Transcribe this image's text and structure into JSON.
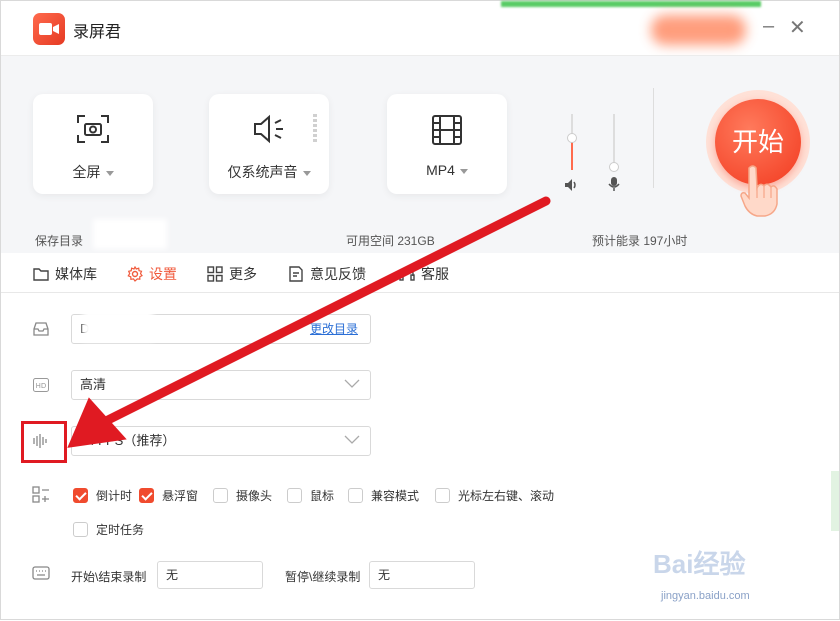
{
  "app": {
    "title": "录屏君"
  },
  "top": {
    "cards": [
      {
        "label": "全屏",
        "icon": "fullscreen-camera-icon"
      },
      {
        "label": "仅系统声音",
        "icon": "speaker-icon"
      },
      {
        "label": "MP4",
        "icon": "film-icon"
      }
    ],
    "start_label": "开始",
    "save_dir_label": "保存目录",
    "free_space": "可用空间  231GB",
    "estimated": "预计能录  197小时"
  },
  "nav": [
    {
      "label": "媒体库",
      "icon": "folder-icon"
    },
    {
      "label": "设置",
      "icon": "gear-icon",
      "active": true
    },
    {
      "label": "更多",
      "icon": "grid-icon"
    },
    {
      "label": "意见反馈",
      "icon": "feedback-icon"
    },
    {
      "label": "客服",
      "icon": "headset-icon"
    }
  ],
  "settings": {
    "dir_value": "D",
    "change_dir": "更改目录",
    "quality": "高清",
    "fps": "24 FPS（推荐）",
    "options": [
      {
        "label": "倒计时",
        "checked": true
      },
      {
        "label": "悬浮窗",
        "checked": true
      },
      {
        "label": "摄像头",
        "checked": false
      },
      {
        "label": "鼠标",
        "checked": false
      },
      {
        "label": "兼容模式",
        "checked": false
      },
      {
        "label": "光标左右键、滚动",
        "checked": false
      },
      {
        "label": "定时任务",
        "checked": false
      }
    ],
    "hotkeys": [
      {
        "label": "开始\\结束录制",
        "value": "无"
      },
      {
        "label": "暂停\\继续录制",
        "value": "无"
      }
    ]
  },
  "watermark": {
    "brand": "Bai经验",
    "url": "jingyan.baidu.com"
  },
  "colors": {
    "accent": "#f05a3c",
    "annotation": "#e01a22"
  }
}
